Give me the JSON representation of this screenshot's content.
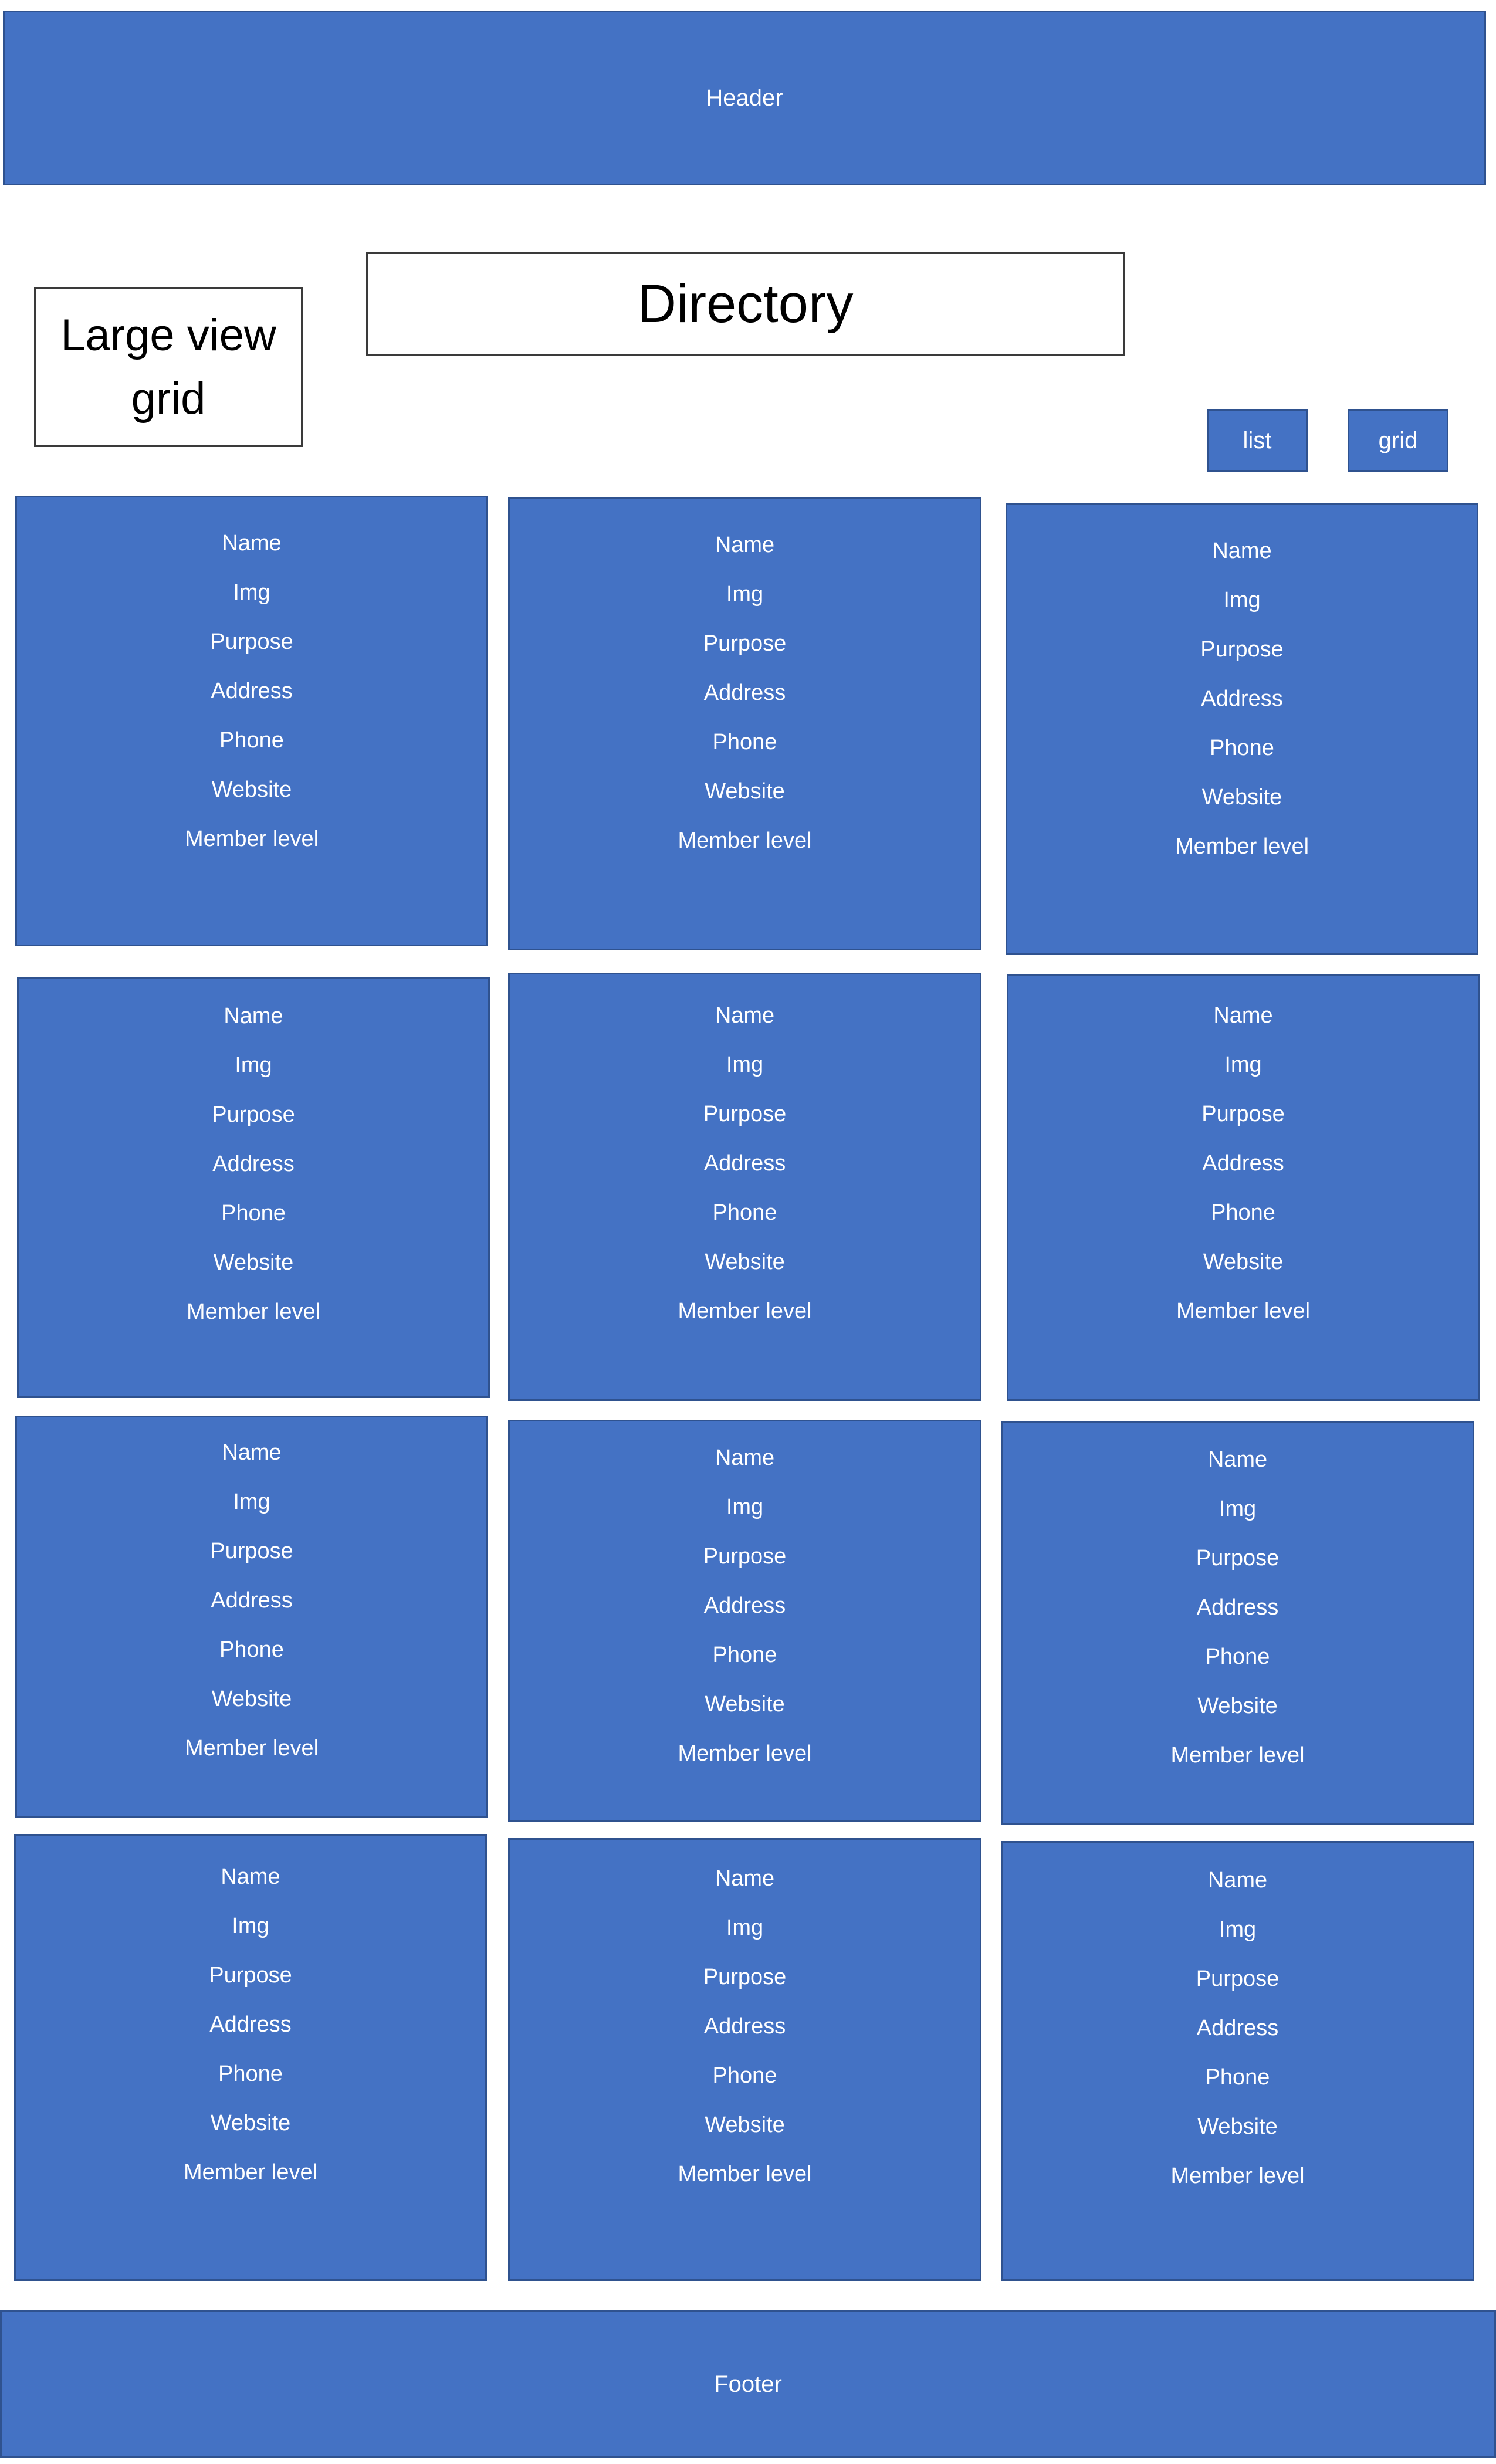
{
  "header": {
    "label": "Header"
  },
  "label_box": {
    "text": "Large view grid"
  },
  "title": "Directory",
  "view_toggle": {
    "list_label": "list",
    "grid_label": "grid"
  },
  "cards": [
    {
      "name": "Name",
      "img": "Img",
      "purpose": "Purpose",
      "address": "Address",
      "phone": "Phone",
      "website": "Website",
      "member_level": "Member level"
    },
    {
      "name": "Name",
      "img": "Img",
      "purpose": "Purpose",
      "address": "Address",
      "phone": "Phone",
      "website": "Website",
      "member_level": "Member level"
    },
    {
      "name": "Name",
      "img": "Img",
      "purpose": "Purpose",
      "address": "Address",
      "phone": "Phone",
      "website": "Website",
      "member_level": "Member level"
    },
    {
      "name": "Name",
      "img": "Img",
      "purpose": "Purpose",
      "address": "Address",
      "phone": "Phone",
      "website": "Website",
      "member_level": "Member level"
    },
    {
      "name": "Name",
      "img": "Img",
      "purpose": "Purpose",
      "address": "Address",
      "phone": "Phone",
      "website": "Website",
      "member_level": "Member level"
    },
    {
      "name": "Name",
      "img": "Img",
      "purpose": "Purpose",
      "address": "Address",
      "phone": "Phone",
      "website": "Website",
      "member_level": "Member level"
    },
    {
      "name": "Name",
      "img": "Img",
      "purpose": "Purpose",
      "address": "Address",
      "phone": "Phone",
      "website": "Website",
      "member_level": "Member level"
    },
    {
      "name": "Name",
      "img": "Img",
      "purpose": "Purpose",
      "address": "Address",
      "phone": "Phone",
      "website": "Website",
      "member_level": "Member level"
    },
    {
      "name": "Name",
      "img": "Img",
      "purpose": "Purpose",
      "address": "Address",
      "phone": "Phone",
      "website": "Website",
      "member_level": "Member level"
    },
    {
      "name": "Name",
      "img": "Img",
      "purpose": "Purpose",
      "address": "Address",
      "phone": "Phone",
      "website": "Website",
      "member_level": "Member level"
    },
    {
      "name": "Name",
      "img": "Img",
      "purpose": "Purpose",
      "address": "Address",
      "phone": "Phone",
      "website": "Website",
      "member_level": "Member level"
    },
    {
      "name": "Name",
      "img": "Img",
      "purpose": "Purpose",
      "address": "Address",
      "phone": "Phone",
      "website": "Website",
      "member_level": "Member level"
    }
  ],
  "footer": {
    "label": "Footer"
  },
  "colors": {
    "accent": "#4472C4",
    "accent_border": "#2F528F",
    "background": "#FFFFFF"
  }
}
